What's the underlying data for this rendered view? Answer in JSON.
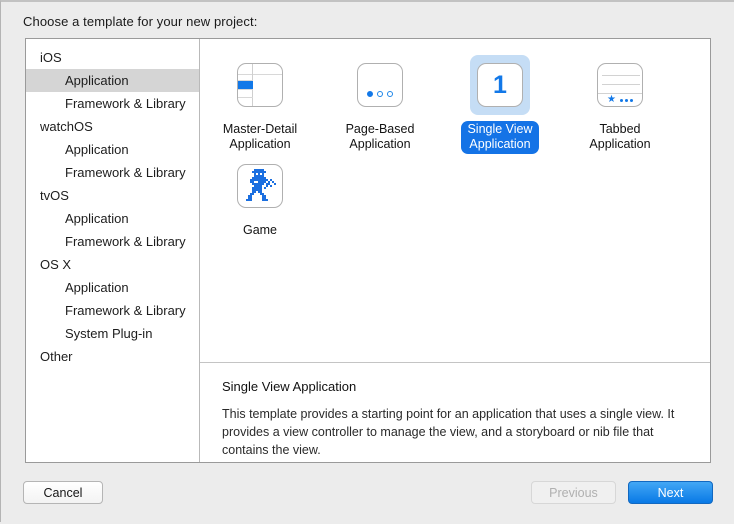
{
  "prompt": "Choose a template for your new project:",
  "sidebar": {
    "items": [
      {
        "label": "iOS",
        "level": "group",
        "selected": false
      },
      {
        "label": "Application",
        "level": "child",
        "selected": true
      },
      {
        "label": "Framework & Library",
        "level": "child",
        "selected": false
      },
      {
        "label": "watchOS",
        "level": "group",
        "selected": false
      },
      {
        "label": "Application",
        "level": "child",
        "selected": false
      },
      {
        "label": "Framework & Library",
        "level": "child",
        "selected": false
      },
      {
        "label": "tvOS",
        "level": "group",
        "selected": false
      },
      {
        "label": "Application",
        "level": "child",
        "selected": false
      },
      {
        "label": "Framework & Library",
        "level": "child",
        "selected": false
      },
      {
        "label": "OS X",
        "level": "group",
        "selected": false
      },
      {
        "label": "Application",
        "level": "child",
        "selected": false
      },
      {
        "label": "Framework & Library",
        "level": "child",
        "selected": false
      },
      {
        "label": "System Plug-in",
        "level": "child",
        "selected": false
      },
      {
        "label": "Other",
        "level": "group",
        "selected": false
      }
    ]
  },
  "templates": [
    {
      "name": "master-detail-application",
      "label": "Master-Detail\nApplication",
      "icon": "master-detail-icon",
      "selected": false
    },
    {
      "name": "page-based-application",
      "label": "Page-Based\nApplication",
      "icon": "page-based-icon",
      "selected": false
    },
    {
      "name": "single-view-application",
      "label": "Single View\nApplication",
      "icon": "single-view-icon",
      "selected": true
    },
    {
      "name": "tabbed-application",
      "label": "Tabbed\nApplication",
      "icon": "tabbed-icon",
      "selected": false
    },
    {
      "name": "game",
      "label": "Game",
      "icon": "game-sprite-icon",
      "selected": false
    }
  ],
  "single_view_icon_number": "1",
  "description": {
    "title": "Single View Application",
    "body": "This template provides a starting point for an application that uses a single view. It provides a view controller to manage the view, and a storyboard or nib file that contains the view."
  },
  "buttons": {
    "cancel": "Cancel",
    "previous": "Previous",
    "next": "Next"
  },
  "colors": {
    "accent_blue": "#1278e8",
    "selection_pill": "#1473e6",
    "selection_halo": "#c5ddf5",
    "sidebar_selection": "#d5d5d5"
  }
}
